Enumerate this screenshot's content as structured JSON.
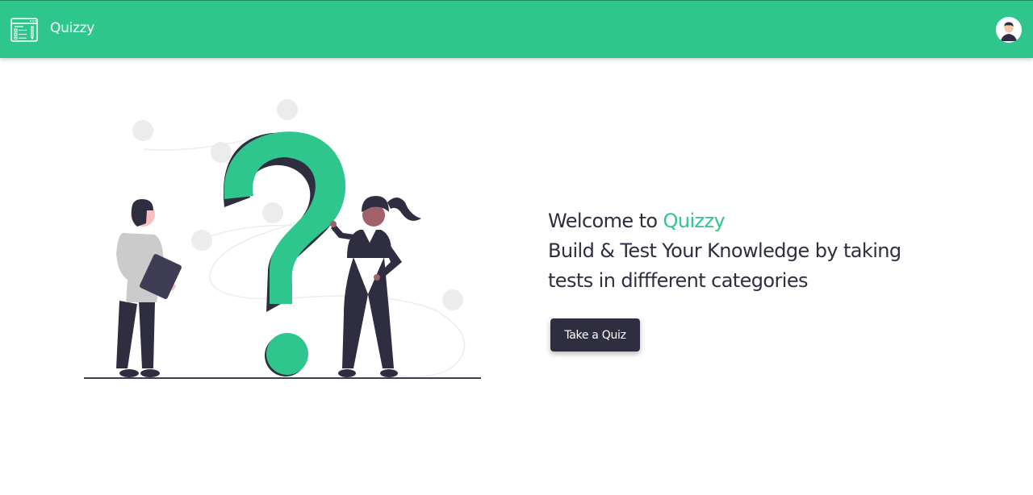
{
  "header": {
    "brand": "Quizzy",
    "logo_icon": "quiz-form-icon",
    "avatar_icon": "user-avatar-icon",
    "background_color": "#2ec68c"
  },
  "hero": {
    "welcome_prefix": "Welcome to ",
    "welcome_brand": "Quizzy",
    "line2": "Build & Test Your Knowledge by taking",
    "line3": "tests in diffferent categories",
    "button_label": "Take a Quiz",
    "accent_color": "#2ec68c",
    "text_color": "#2f2e41"
  },
  "illustration": {
    "icon": "question-mark-people-illustration"
  }
}
